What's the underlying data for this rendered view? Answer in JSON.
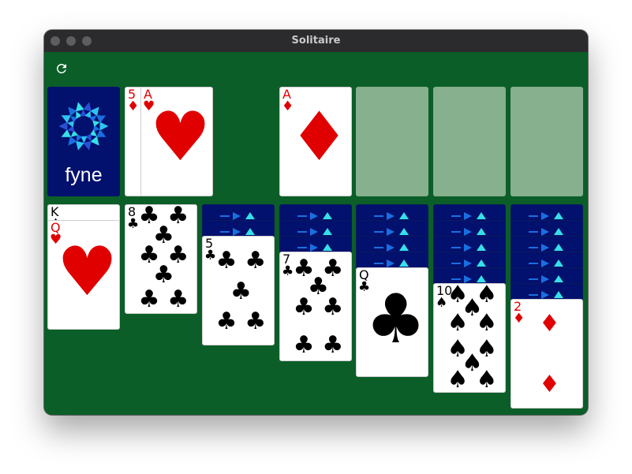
{
  "window": {
    "title": "Solitaire"
  },
  "toolbar": {
    "refresh_icon": "refresh-icon"
  },
  "deck": {
    "logo_text": "fyne",
    "logo_icon": "fyne-logo-icon"
  },
  "waste": [
    {
      "rank": "5",
      "suit": "♦",
      "color": "red"
    },
    {
      "rank": "A",
      "suit": "♥",
      "color": "red"
    }
  ],
  "foundations": [
    {
      "rank": "A",
      "suit": "♦",
      "color": "red"
    },
    {
      "empty": true
    },
    {
      "empty": true
    },
    {
      "empty": true
    }
  ],
  "tableau": [
    {
      "hidden": 0,
      "cards": [
        {
          "rank": "K",
          "suit": "♠",
          "color": "black"
        },
        {
          "rank": "Q",
          "suit": "♥",
          "color": "red"
        }
      ]
    },
    {
      "hidden": 0,
      "cards": [
        {
          "rank": "8",
          "suit": "♣",
          "color": "black"
        }
      ]
    },
    {
      "hidden": 2,
      "cards": [
        {
          "rank": "5",
          "suit": "♣",
          "color": "black"
        }
      ]
    },
    {
      "hidden": 3,
      "cards": [
        {
          "rank": "7",
          "suit": "♣",
          "color": "black"
        }
      ]
    },
    {
      "hidden": 4,
      "cards": [
        {
          "rank": "Q",
          "suit": "♣",
          "color": "black"
        }
      ]
    },
    {
      "hidden": 5,
      "cards": [
        {
          "rank": "10",
          "suit": "♠",
          "color": "black"
        }
      ]
    },
    {
      "hidden": 6,
      "cards": [
        {
          "rank": "2",
          "suit": "♦",
          "color": "red"
        }
      ]
    }
  ],
  "colors": {
    "felt": "#0b5e28",
    "slot": "#86b08e",
    "card_back": "#02106e",
    "red": "#e00000"
  }
}
